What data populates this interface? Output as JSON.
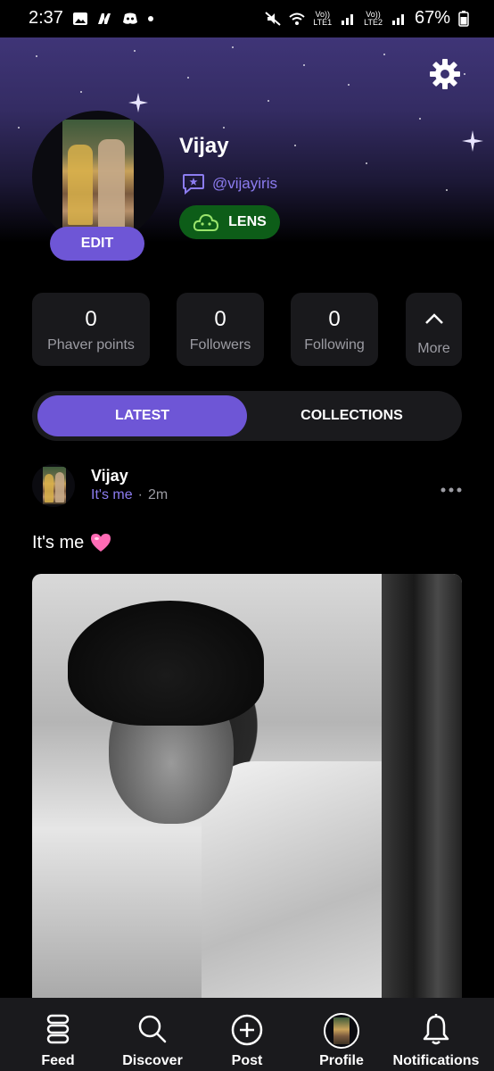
{
  "status_bar": {
    "time": "2:37",
    "battery": "67%",
    "net1_top": "Vo))",
    "net1_bottom": "LTE1",
    "net2_top": "Vo))",
    "net2_bottom": "LTE2"
  },
  "profile": {
    "name": "Vijay",
    "handle": "@vijayiris",
    "edit_label": "EDIT",
    "lens_label": "LENS"
  },
  "stats": [
    {
      "value": "0",
      "label": "Phaver points"
    },
    {
      "value": "0",
      "label": "Followers"
    },
    {
      "value": "0",
      "label": "Following"
    }
  ],
  "more_label": "More",
  "tabs": {
    "latest": "LATEST",
    "collections": "COLLECTIONS",
    "active": "LATEST"
  },
  "post": {
    "author": "Vijay",
    "tag": "It's me",
    "separator": "·",
    "time": "2m",
    "caption": "It's me"
  },
  "nav": {
    "feed": "Feed",
    "discover": "Discover",
    "post": "Post",
    "profile": "Profile",
    "notifications": "Notifications"
  },
  "colors": {
    "accent": "#6e56d6",
    "handle": "#8c7cf0",
    "lens_bg": "#0d5d18",
    "card_bg": "#19191c"
  }
}
